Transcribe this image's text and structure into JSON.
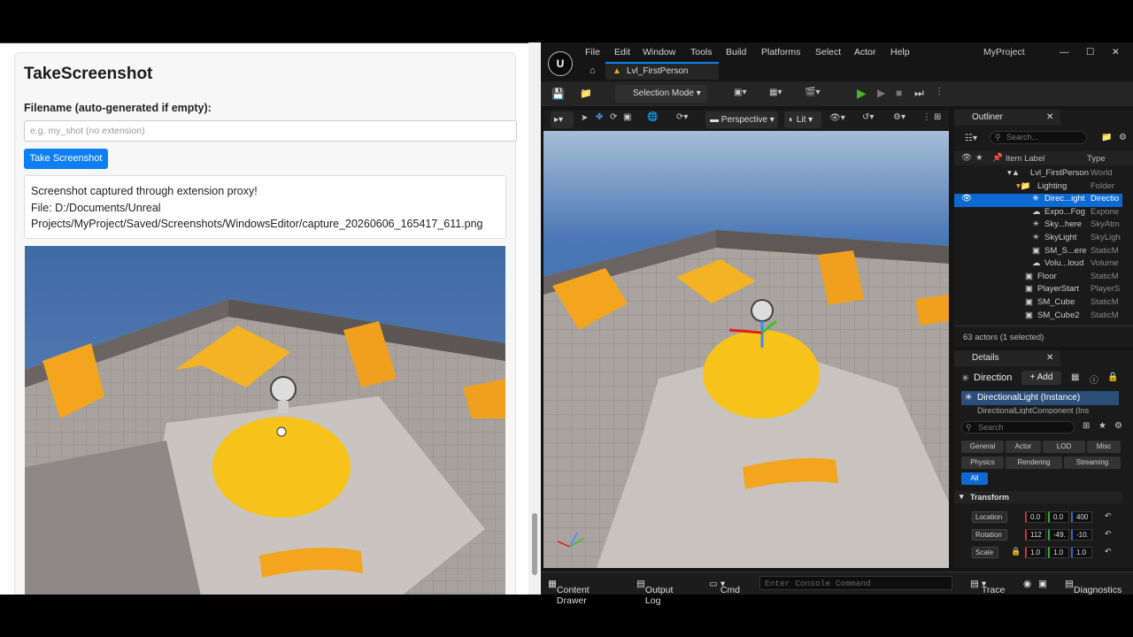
{
  "browser": {
    "title": "TakeScreenshot",
    "filename_label": "Filename (auto-generated if empty):",
    "filename_placeholder": "e.g. my_shot (no extension)",
    "button_label": "Take Screenshot",
    "output_line1": "Screenshot captured through extension proxy!",
    "output_line2": "File: D:/Documents/Unreal",
    "output_line3": "Projects/MyProject/Saved/Screenshots/WindowsEditor/capture_20260606_165417_611.png"
  },
  "editor": {
    "project": "MyProject",
    "menu": [
      "File",
      "Edit",
      "Window",
      "Tools",
      "Build",
      "Platforms",
      "Select",
      "Actor",
      "Help"
    ],
    "level_tab": "Lvl_FirstPerson",
    "selection_mode": "Selection Mode",
    "viewport_mode": "Perspective",
    "lit_mode": "Lit",
    "outliner": {
      "title": "Outliner",
      "search_placeholder": "Search...",
      "col_label": "Item Label",
      "col_type": "Type",
      "rows": [
        {
          "label": "Lvl_FirstPerson",
          "type": "World"
        },
        {
          "label": "Lighting",
          "type": "Folder"
        },
        {
          "label": "Direc...ight",
          "type": "Directio"
        },
        {
          "label": "Expo...Fog",
          "type": "Expone"
        },
        {
          "label": "Sky...here",
          "type": "SkyAtm"
        },
        {
          "label": "SkyLight",
          "type": "SkyLigh"
        },
        {
          "label": "SM_S...ere",
          "type": "StaticM"
        },
        {
          "label": "Volu...loud",
          "type": "Volume"
        },
        {
          "label": "Floor",
          "type": "StaticM"
        },
        {
          "label": "PlayerStart",
          "type": "PlayerS"
        },
        {
          "label": "SM_Cube",
          "type": "StaticM"
        },
        {
          "label": "SM_Cube2",
          "type": "StaticM"
        }
      ],
      "status": "63 actors (1 selected)"
    },
    "details": {
      "title": "Details",
      "actor_name": "Direction",
      "add_label": "+ Add",
      "instance": "DirectionalLight (Instance)",
      "component": "DirectionalLightComponent (Ins",
      "search_placeholder": "Search",
      "filters": [
        "General",
        "Actor",
        "LOD",
        "Misc",
        "Physics",
        "Rendering",
        "Streaming",
        "All"
      ],
      "section": "Transform",
      "location_label": "Location",
      "rotation_label": "Rotation",
      "scale_label": "Scale",
      "location": [
        "0.0",
        "0.0",
        "400"
      ],
      "rotation": [
        "112",
        "-49.",
        "-10."
      ],
      "scale": [
        "1.0",
        "1.0",
        "1.0"
      ]
    },
    "bottom": {
      "content_drawer": "Content Drawer",
      "output_log": "Output Log",
      "cmd": "Cmd",
      "console_placeholder": "Enter Console Command",
      "trace": "Trace",
      "diagnostics": "Diagnostics"
    }
  }
}
